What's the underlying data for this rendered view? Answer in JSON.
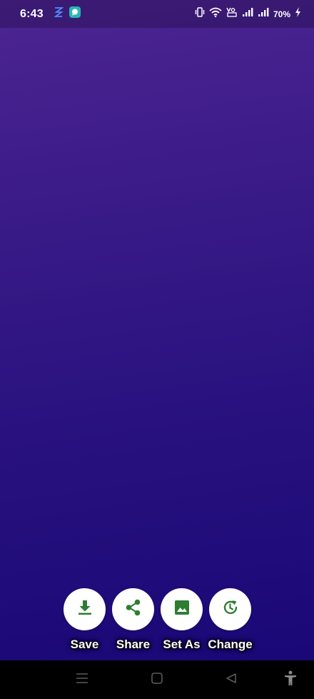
{
  "status_bar": {
    "time": "6:43",
    "battery_percent": "70%",
    "icons": [
      "vibrate-icon",
      "wifi-icon",
      "volte-icon",
      "signal-icon",
      "signal-icon",
      "charging-icon"
    ],
    "notification_icons": [
      "app-notification-icon",
      "chat-bubble-icon"
    ]
  },
  "wallpaper": {
    "gradient_colors": [
      "#4d2592",
      "#27117e",
      "#1a0877"
    ]
  },
  "actions": [
    {
      "label": "Save",
      "icon": "download-icon"
    },
    {
      "label": "Share",
      "icon": "share-icon"
    },
    {
      "label": "Set As",
      "icon": "image-icon"
    },
    {
      "label": "Change",
      "icon": "refresh-clock-icon"
    }
  ],
  "colors": {
    "accent": "#2e7d32",
    "button_bg": "#ffffff",
    "nav_bg": "#000000"
  },
  "nav_bar": {
    "icons": [
      "menu-icon",
      "home-icon",
      "back-icon",
      "accessibility-icon"
    ]
  }
}
